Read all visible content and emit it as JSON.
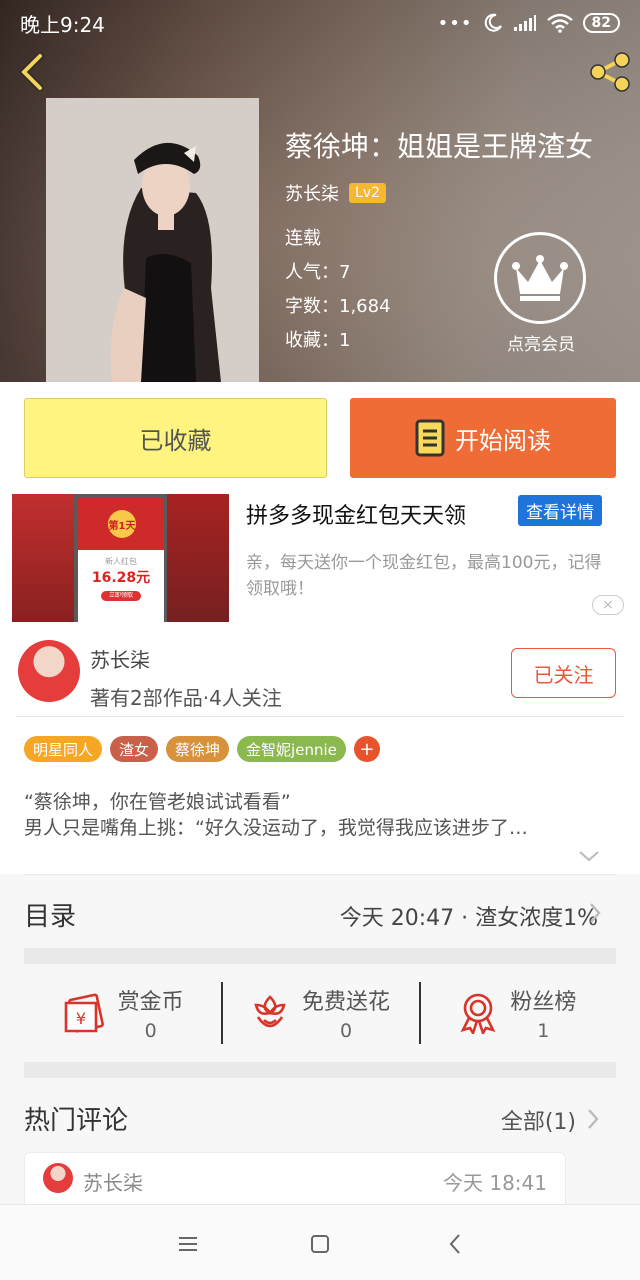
{
  "status_bar": {
    "time": "晚上9:24",
    "battery": "82"
  },
  "book": {
    "title": "蔡徐坤：姐姐是王牌渣女",
    "author": "苏长柒",
    "author_level": "Lv2",
    "status": "连载",
    "popularity_label": "人气：7",
    "word_count_label": "字数：1,684",
    "favorites_label": "收藏：1",
    "vip_label": "点亮会员"
  },
  "actions": {
    "collected_label": "已收藏",
    "read_label": "开始阅读"
  },
  "ad": {
    "title": "拼多多现金红包天天领",
    "detail_button": "查看详情",
    "description": "亲，每天送你一个现金红包，最高100元，记得领取哦！",
    "card_day": "第1天",
    "card_label": "新人红包",
    "card_amount": "16.28元",
    "card_button": "立即领取",
    "close_icon": "×"
  },
  "author_block": {
    "name": "苏长柒",
    "subtitle": "著有2部作品·4人关注",
    "follow_label": "已关注"
  },
  "tags": [
    {
      "label": "明星同人",
      "color": "#f5a623"
    },
    {
      "label": "渣女",
      "color": "#c9614a"
    },
    {
      "label": "蔡徐坤",
      "color": "#d8923b"
    },
    {
      "label": "金智妮jennie",
      "color": "#8cb94f"
    }
  ],
  "tag_add": "+",
  "intro": {
    "line1": "“蔡徐坤，你在管老娘试试看看”",
    "line2": "男人只是嘴角上挑：“好久没运动了，我觉得我应该进步了…"
  },
  "toc": {
    "title": "目录",
    "info": "今天 20:47 · 渣女浓度1%"
  },
  "stats": [
    {
      "label": "赏金币",
      "value": "0",
      "icon": "red-envelope-icon"
    },
    {
      "label": "免费送花",
      "value": "0",
      "icon": "flower-icon"
    },
    {
      "label": "粉丝榜",
      "value": "1",
      "icon": "medal-icon"
    }
  ],
  "hot_comments": {
    "title": "热门评论",
    "all_label": "全部(1)",
    "first": {
      "user": "苏长柒",
      "time": "今天 18:41"
    }
  },
  "colors": {
    "accent_orange": "#ef6c36",
    "collected_yellow": "#fff480",
    "icon_red": "#d8342a"
  }
}
